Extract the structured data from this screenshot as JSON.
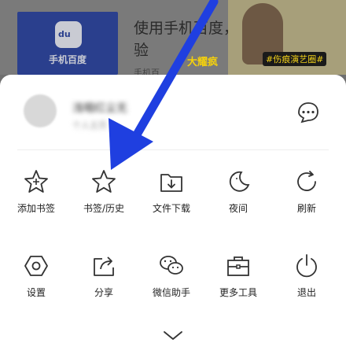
{
  "background_page": {
    "logo_badge_text": "du",
    "logo_name": "手机百度",
    "title": "使用手机百度，更顺畅搜索体验",
    "subtitle": "手机百",
    "promo_tag": "#伤痕演艺圈#",
    "promo_brand": "大耀疯"
  },
  "profile": {
    "name": "浅唱红尘无",
    "subtitle": "个人主页"
  },
  "menu_row1": [
    {
      "label": "添加书签",
      "icon": "star-plus-icon"
    },
    {
      "label": "书签/历史",
      "icon": "star-icon"
    },
    {
      "label": "文件下载",
      "icon": "download-folder-icon"
    },
    {
      "label": "夜间",
      "icon": "moon-icon"
    },
    {
      "label": "刷新",
      "icon": "refresh-icon"
    }
  ],
  "menu_row2": [
    {
      "label": "设置",
      "icon": "settings-hexagon-icon"
    },
    {
      "label": "分享",
      "icon": "share-icon"
    },
    {
      "label": "微信助手",
      "icon": "wechat-icon"
    },
    {
      "label": "更多工具",
      "icon": "toolbox-icon"
    },
    {
      "label": "退出",
      "icon": "power-icon"
    }
  ],
  "colors": {
    "overlay": "#6f6f6f",
    "sheet": "#ffffff",
    "icon_stroke": "#333333",
    "annotation_arrow": "#1f3fe0"
  }
}
